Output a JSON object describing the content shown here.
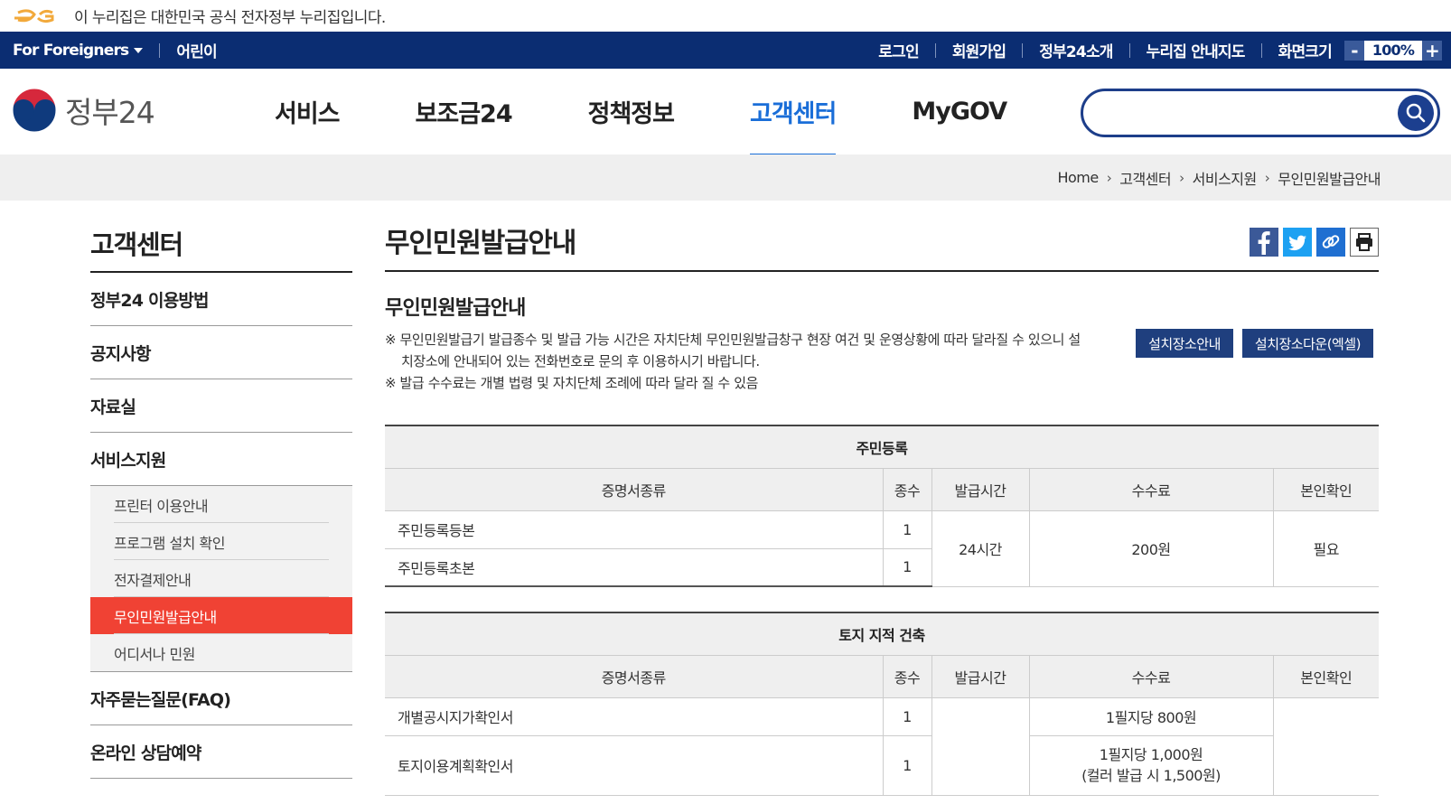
{
  "notice": {
    "text": "이 누리집은 대한민국 공식 전자정부 누리집입니다."
  },
  "util": {
    "foreigners": "For Foreigners",
    "kids": "어린이",
    "links": [
      "로그인",
      "회원가입",
      "정부24소개",
      "누리집 안내지도"
    ],
    "zoom_label": "화면크기",
    "zoom_minus": "-",
    "zoom_value": "100%",
    "zoom_plus": "+"
  },
  "gnb": {
    "logo_text": "정부24",
    "menu": [
      "서비스",
      "보조금24",
      "정책정보",
      "고객센터",
      "MyGOV"
    ],
    "active_menu": "고객센터",
    "search_placeholder": ""
  },
  "breadcrumb": [
    "Home",
    "고객센터",
    "서비스지원",
    "무인민원발급안내"
  ],
  "lnb": {
    "title": "고객센터",
    "items": [
      "정부24 이용방법",
      "공지사항",
      "자료실",
      "서비스지원"
    ],
    "sub_items": [
      "프린터 이용안내",
      "프로그램 설치 확인",
      "전자결제안내",
      "무인민원발급안내",
      "어디서나 민원"
    ],
    "active_sub": "무인민원발급안내",
    "items_after": [
      "자주묻는질문(FAQ)",
      "온라인 상담예약"
    ]
  },
  "content": {
    "page_title": "무인민원발급안내",
    "section_title": "무인민원발급안내",
    "notes": [
      "※ 무인민원발급기 발급종수 및 발급 가능 시간은 자치단체 무인민원발급창구 현장 여건 및 운영상황에 따라 달라질 수 있으니 설치장소에 안내되어 있는 전화번호로 문의 후 이용하시기 바랍니다.",
      "※ 발급 수수료는 개별 법령 및 자치단체 조례에 따라 달라 질 수 있음"
    ],
    "buttons": [
      "설치장소안내",
      "설치장소다운(엑셀)"
    ],
    "table_headers": [
      "증명서종류",
      "종수",
      "발급시간",
      "수수료",
      "본인확인"
    ],
    "table1": {
      "caption": "주민등록",
      "rows": [
        {
          "name": "주민등록등본",
          "count": "1"
        },
        {
          "name": "주민등록초본",
          "count": "1"
        }
      ],
      "time": "24시간",
      "fee": "200원",
      "verify": "필요"
    },
    "table2": {
      "caption": "토지 지적 건축",
      "rows": [
        {
          "name": "개별공시지가확인서",
          "count": "1",
          "fee": "1필지당 800원"
        },
        {
          "name": "토지이용계획확인서",
          "count": "1",
          "fee": "1필지당 1,000원",
          "fee_note": "(컬러 발급 시 1,500원)"
        }
      ]
    }
  },
  "colors": {
    "util_bar": "#0b2d72",
    "active_menu": "#1a6ed8",
    "active_sub": "#f04234",
    "button": "#1f3f7e"
  }
}
